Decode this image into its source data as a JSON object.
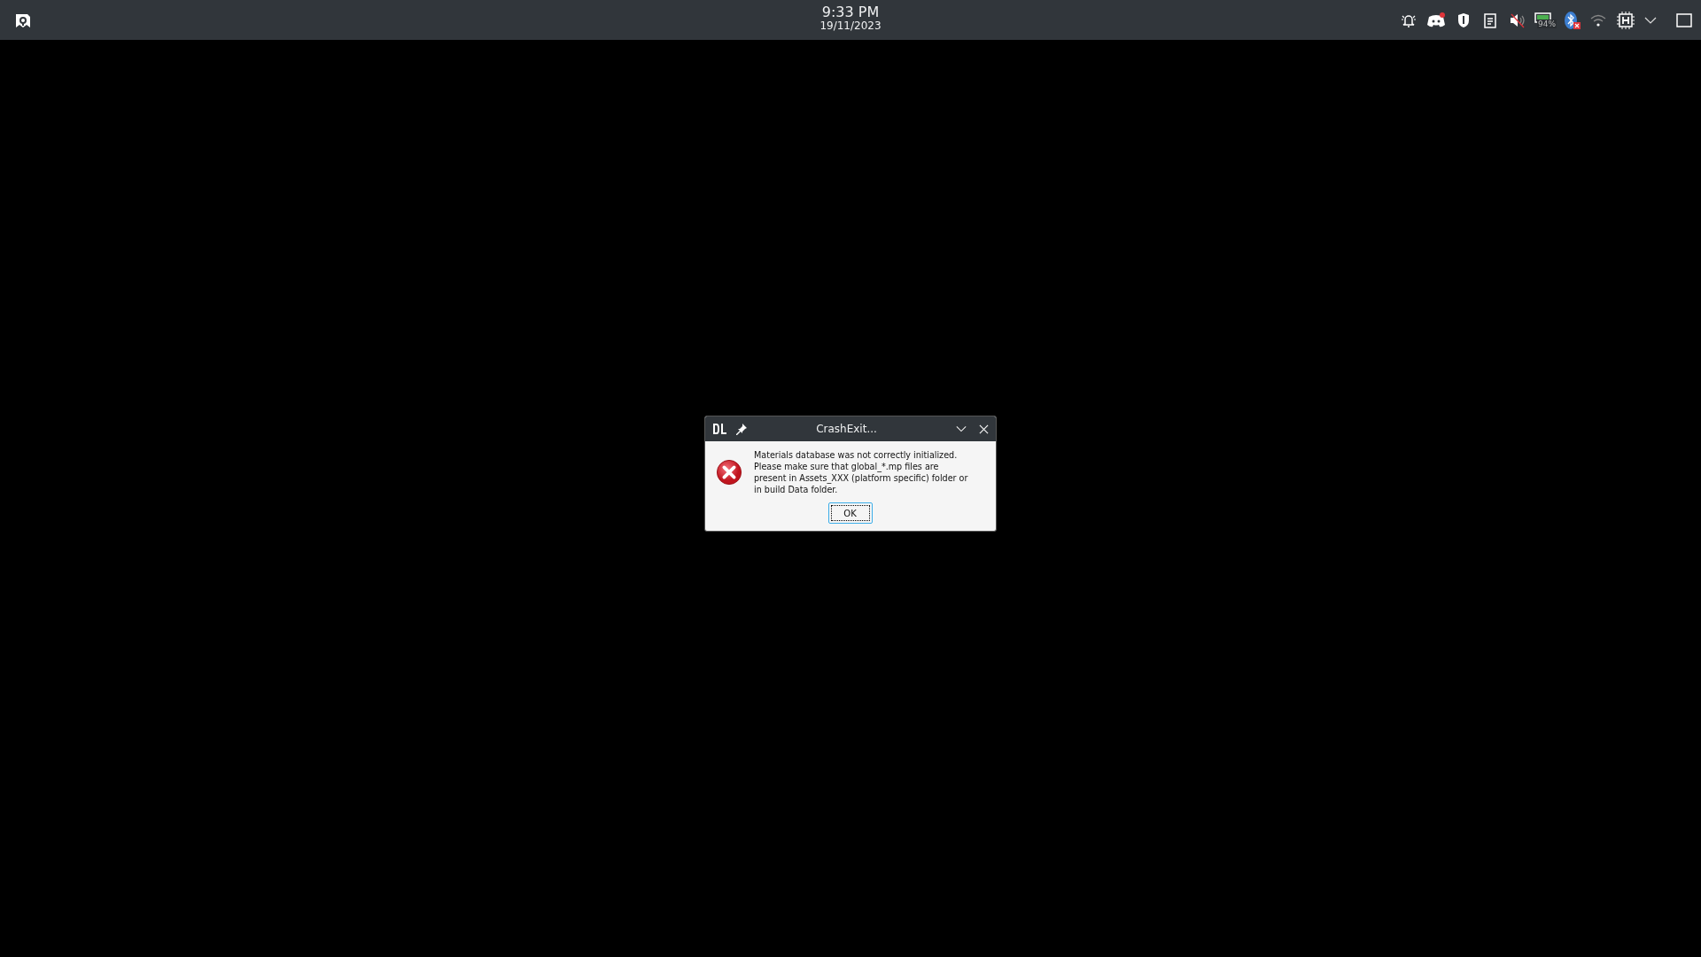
{
  "panel": {
    "time": "9:33 PM",
    "date": "19/11/2023",
    "battery_label": "94%"
  },
  "dialog": {
    "title": "CrashExit...",
    "message": "Materials database was not correctly initialized. Please make sure that global_*.mp files are present in Assets_XXX (platform specific) folder or in build Data folder.",
    "buttons": [
      "OK"
    ]
  }
}
